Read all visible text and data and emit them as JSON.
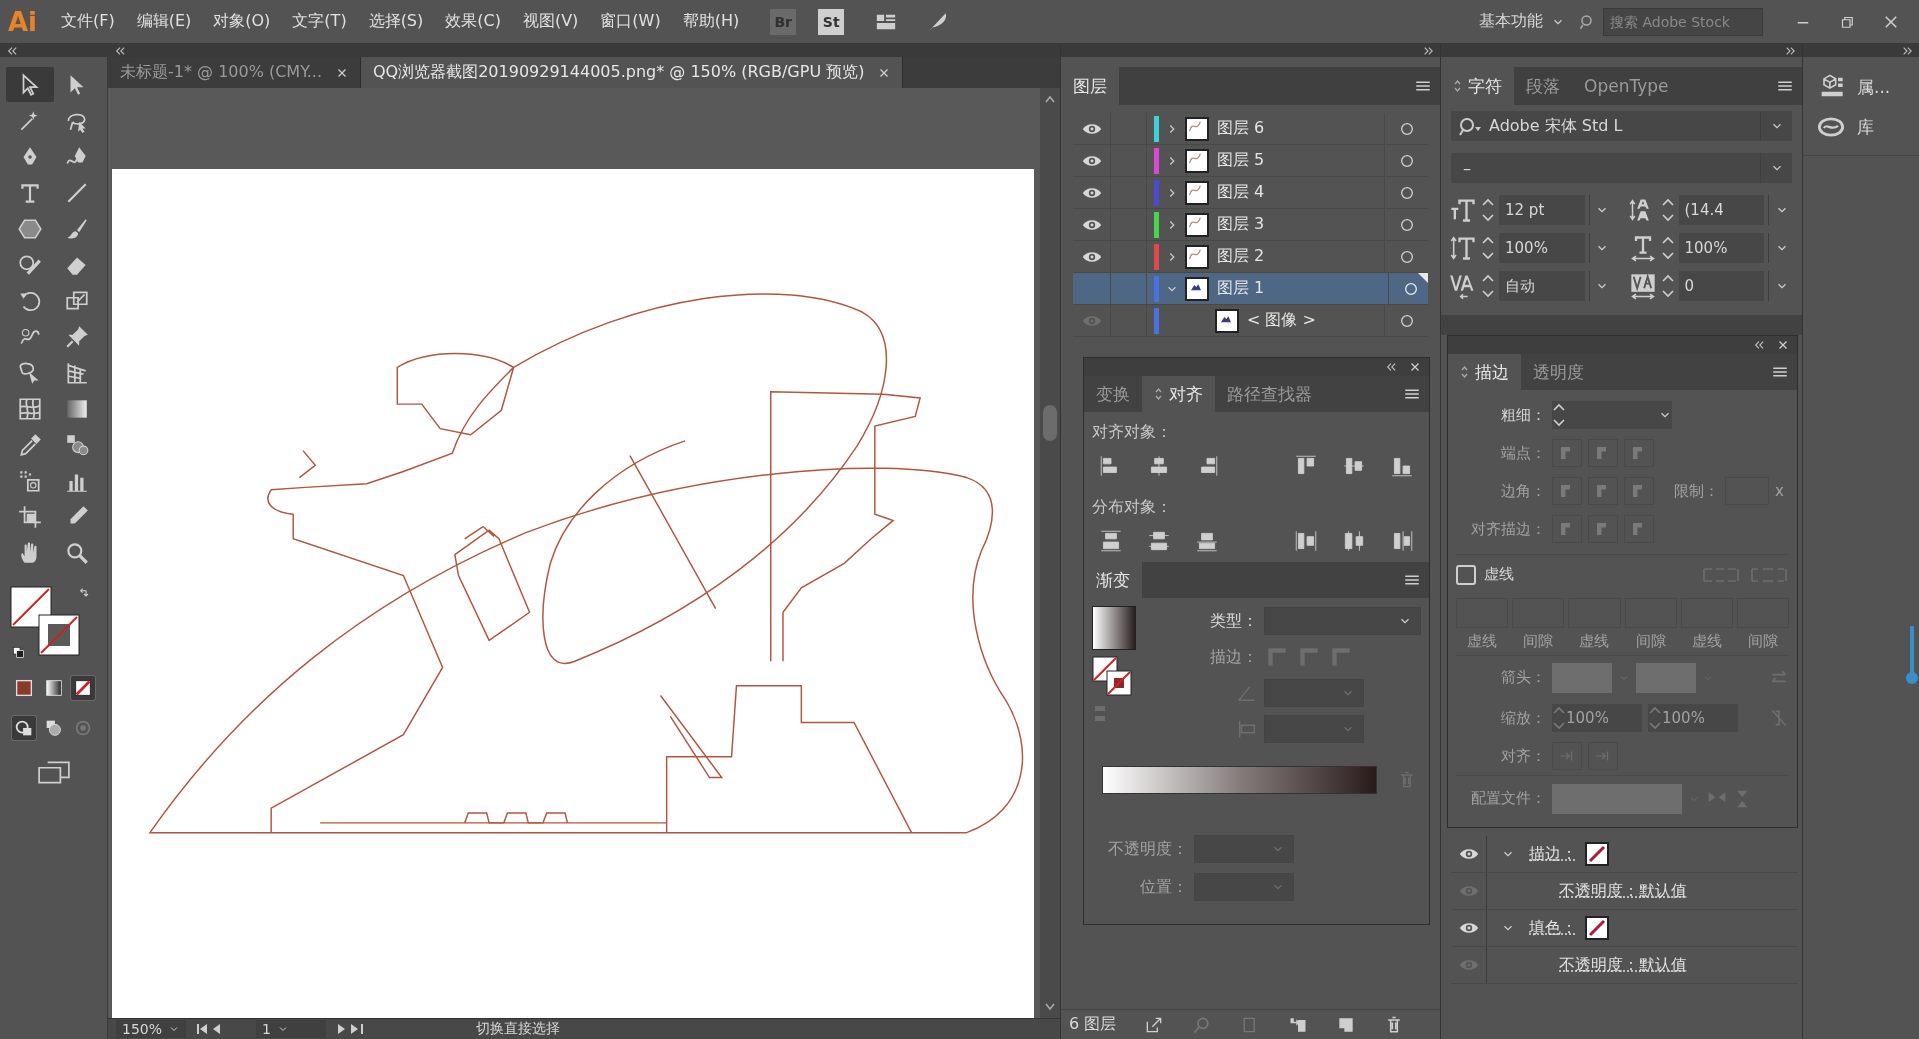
{
  "app": {
    "logo": "Ai"
  },
  "menu": [
    "文件(F)",
    "编辑(E)",
    "对象(O)",
    "文字(T)",
    "选择(S)",
    "效果(C)",
    "视图(V)",
    "窗口(W)",
    "帮助(H)"
  ],
  "bridge_buttons": [
    {
      "label": "Br",
      "disabled": true
    },
    {
      "label": "St",
      "disabled": false
    }
  ],
  "workspace": {
    "label": "基本功能"
  },
  "search": {
    "placeholder": "搜索 Adobe Stock"
  },
  "doc_tabs": [
    {
      "label": "未标题-1* @ 100% (CMY...",
      "selected": false
    },
    {
      "label": "QQ浏览器截图20190929144005.png* @ 150% (RGB/GPU 预览)",
      "selected": true
    }
  ],
  "tools": [
    {
      "kind": "selection",
      "selected": true
    },
    {
      "kind": "direct",
      "selected": false
    },
    {
      "kind": "wand",
      "selected": false
    },
    {
      "kind": "lasso",
      "selected": false
    },
    {
      "kind": "pen",
      "selected": false
    },
    {
      "kind": "curvature",
      "selected": false
    },
    {
      "kind": "type",
      "selected": false
    },
    {
      "kind": "line",
      "selected": false
    },
    {
      "kind": "polygon",
      "selected": false
    },
    {
      "kind": "brush",
      "selected": false
    },
    {
      "kind": "shaper",
      "selected": false
    },
    {
      "kind": "eraser",
      "selected": false
    },
    {
      "kind": "rotate",
      "selected": false
    },
    {
      "kind": "scale",
      "selected": false
    },
    {
      "kind": "warp",
      "selected": false
    },
    {
      "kind": "pin",
      "selected": false
    },
    {
      "kind": "freetransform",
      "selected": false
    },
    {
      "kind": "perspective",
      "selected": false
    },
    {
      "kind": "mesh",
      "selected": false
    },
    {
      "kind": "gradient",
      "selected": false
    },
    {
      "kind": "eyedropper",
      "selected": false
    },
    {
      "kind": "blend",
      "selected": false
    },
    {
      "kind": "sprayer",
      "selected": false
    },
    {
      "kind": "graph",
      "selected": false
    },
    {
      "kind": "artboard",
      "selected": false
    },
    {
      "kind": "knife",
      "selected": false
    },
    {
      "kind": "hand",
      "selected": false
    },
    {
      "kind": "zoom",
      "selected": false
    }
  ],
  "color_modes": [
    {
      "kind": "color",
      "selected": false
    },
    {
      "kind": "gradient",
      "selected": false
    },
    {
      "kind": "none",
      "selected": true
    }
  ],
  "draw_modes": [
    {
      "kind": "normal",
      "selected": true
    },
    {
      "kind": "behind",
      "selected": false
    },
    {
      "kind": "inside",
      "selected": false
    }
  ],
  "status_bar": {
    "zoom": "150%",
    "artboard": "1",
    "status": "切换直接选择"
  },
  "layers": {
    "title": "图层",
    "count": "6 图层",
    "rows": [
      {
        "name": "图层 6",
        "color": "#3fd0dc",
        "visible": true,
        "expanded": false,
        "selected": false
      },
      {
        "name": "图层 5",
        "color": "#d84ad4",
        "visible": true,
        "expanded": false,
        "selected": false
      },
      {
        "name": "图层 4",
        "color": "#4a4ad8",
        "visible": true,
        "expanded": false,
        "selected": false
      },
      {
        "name": "图层 3",
        "color": "#4ad44a",
        "visible": true,
        "expanded": false,
        "selected": false
      },
      {
        "name": "图层 2",
        "color": "#e04a4a",
        "visible": true,
        "expanded": false,
        "selected": false
      },
      {
        "name": "图层 1",
        "color": "#4a72e0",
        "visible": false,
        "expanded": true,
        "selected": true,
        "children": [
          {
            "name": "< 图像 >",
            "color": "#4a72e0",
            "visible": true,
            "selected": false
          }
        ]
      }
    ]
  },
  "align": {
    "tabs": [
      {
        "label": "变换",
        "selected": false
      },
      {
        "label": "对齐",
        "selected": true
      },
      {
        "label": "路径查找器",
        "selected": false
      }
    ],
    "align_label": "对齐对象：",
    "distribute_label": "分布对象："
  },
  "gradient": {
    "title": "渐变",
    "type_label": "类型：",
    "disabled": true,
    "stroke_label": "描边：",
    "opacity_label": "不透明度：",
    "location_label": "位置："
  },
  "character": {
    "tabs": [
      {
        "label": "字符",
        "selected": true
      },
      {
        "label": "段落",
        "selected": false
      },
      {
        "label": "OpenType",
        "selected": false
      }
    ],
    "font": "Adobe 宋体 Std L",
    "style": "–",
    "fields": [
      {
        "kind": "size",
        "value": "12 pt"
      },
      {
        "kind": "leading",
        "value": "(14.4"
      },
      {
        "kind": "vscale",
        "value": "100%"
      },
      {
        "kind": "hscale",
        "value": "100%"
      },
      {
        "kind": "kerning",
        "value": "自动"
      },
      {
        "kind": "tracking",
        "value": "0"
      }
    ]
  },
  "stroke": {
    "tabs": [
      {
        "label": "描边",
        "selected": true
      },
      {
        "label": "透明度",
        "selected": false
      }
    ],
    "disabled": true,
    "weight_label": "粗细：",
    "cap_label": "端点：",
    "corner_label": "边角：",
    "limit_label": "限制：",
    "limit_unit": "x",
    "align_label": "对齐描边：",
    "dashed": {
      "label": "虚线",
      "checked": false
    },
    "dash_labels": [
      "虚线",
      "间隙",
      "虚线",
      "间隙",
      "虚线",
      "间隙"
    ],
    "arrow_label": "箭头：",
    "scale_label": "缩放：",
    "scale_values": [
      "100%",
      "100%"
    ],
    "arrow_align_label": "对齐：",
    "profile_label": "配置文件："
  },
  "appearance": [
    {
      "kind": "attribute",
      "label": "描边：",
      "visible": true,
      "expanded": true
    },
    {
      "kind": "opacity",
      "label": "不透明度：默认值"
    },
    {
      "kind": "attribute",
      "label": "填色：",
      "visible": true,
      "expanded": true
    },
    {
      "kind": "opacity",
      "label": "不透明度：默认值"
    }
  ],
  "dock": [
    {
      "kind": "properties",
      "label": "属..."
    },
    {
      "kind": "libraries",
      "label": "库"
    }
  ]
}
